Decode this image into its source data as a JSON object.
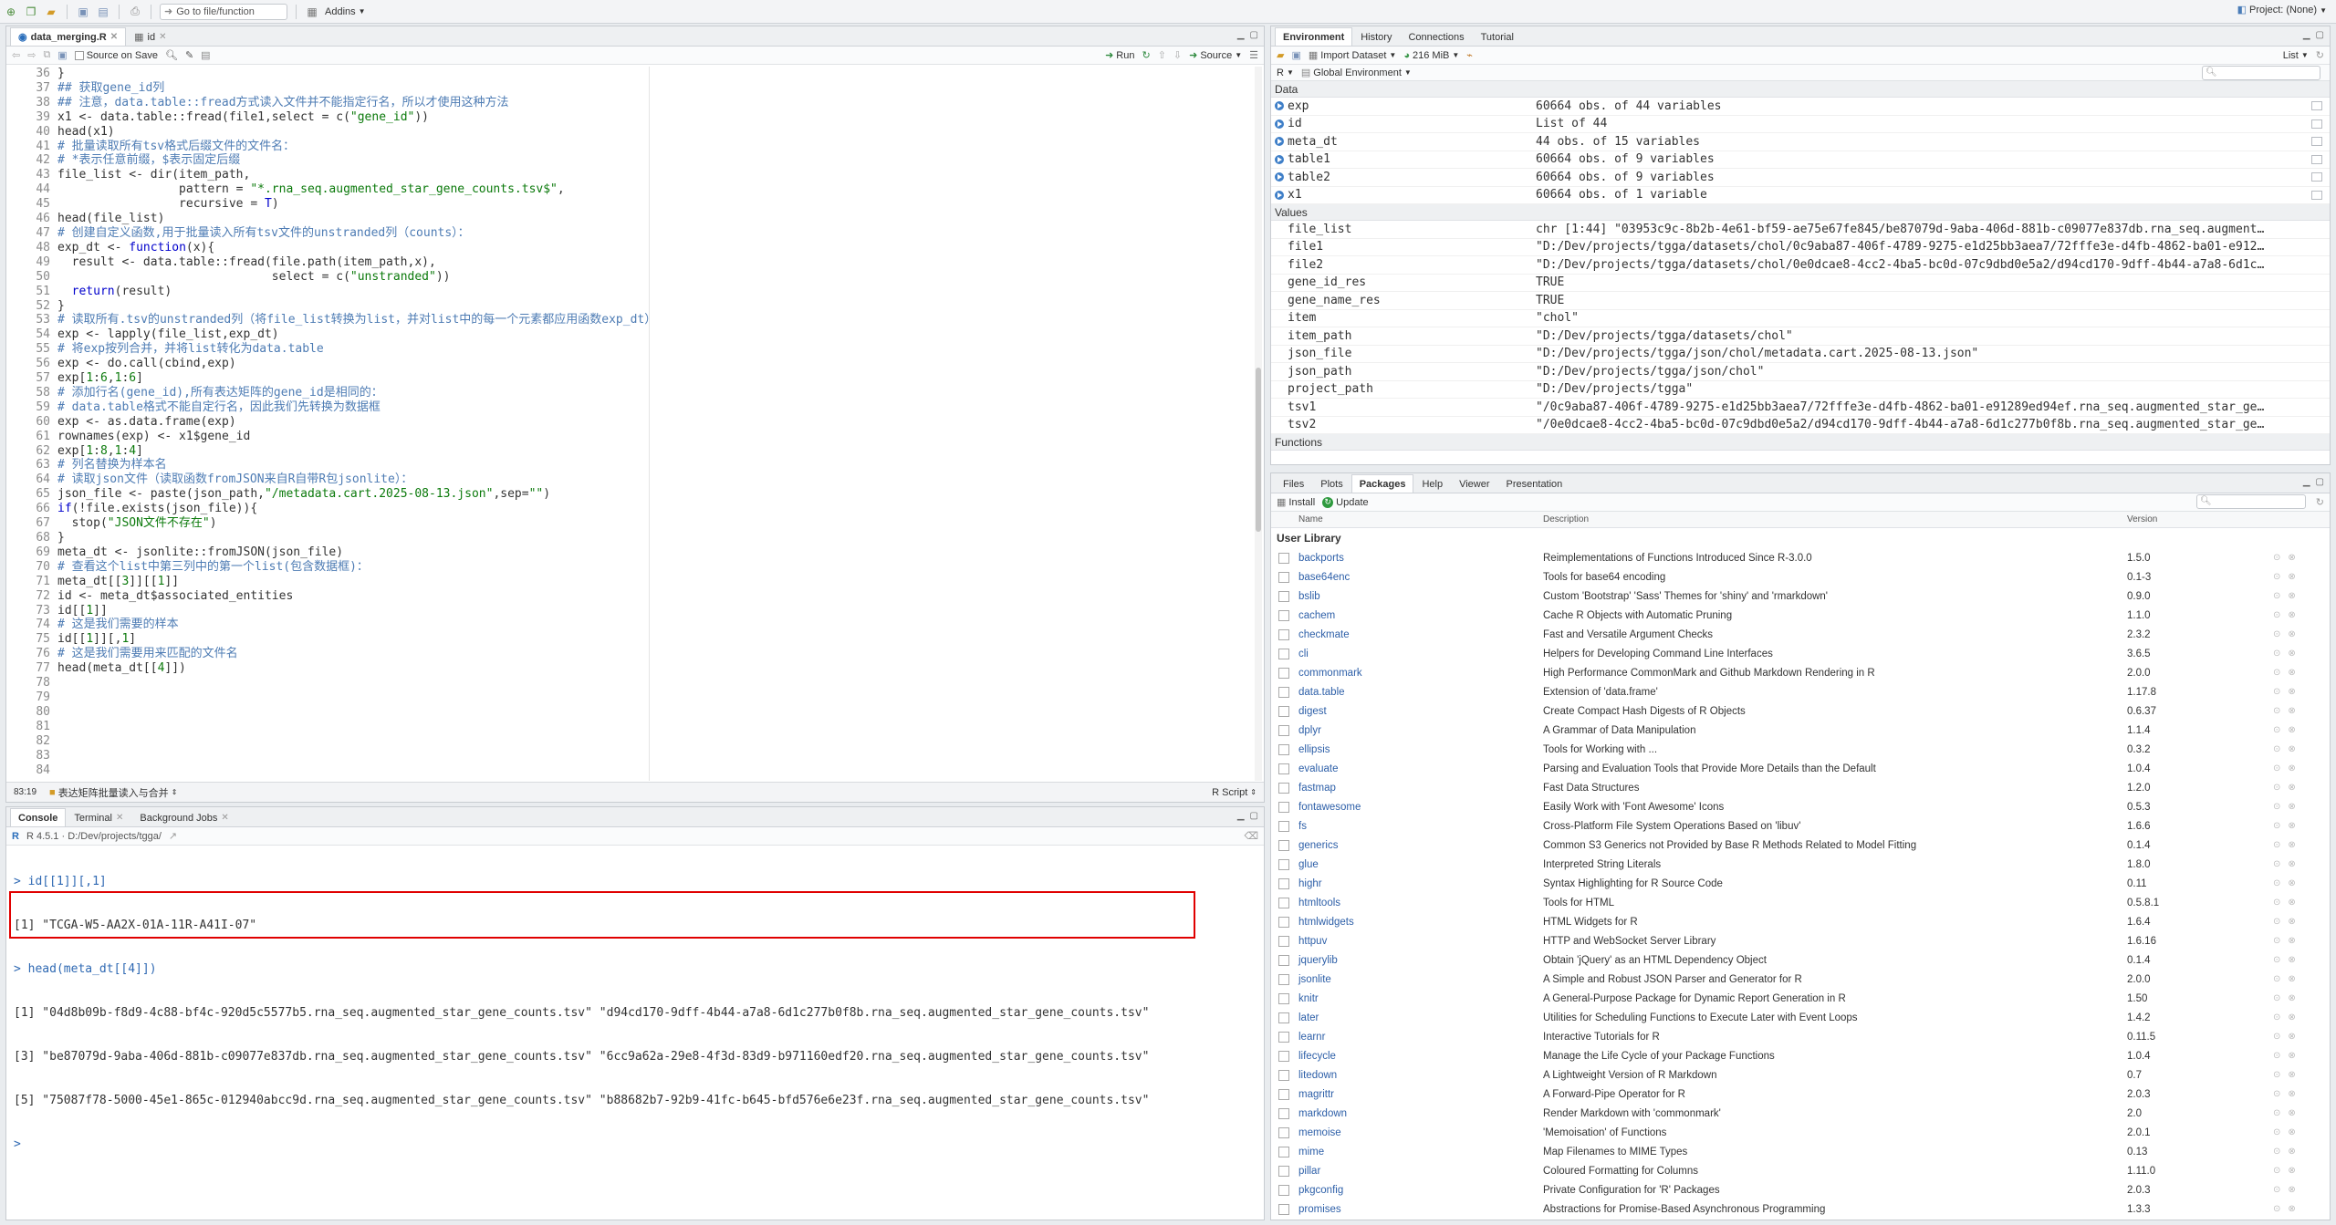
{
  "toolbar": {
    "goto_placeholder": "Go to file/function",
    "addins": "Addins",
    "project": "Project: (None)"
  },
  "editor": {
    "tabs": [
      {
        "label": "data_merging.R"
      },
      {
        "label": "id"
      }
    ],
    "source_on_save": "Source on Save",
    "run": "Run",
    "source": "Source",
    "status_pos": "83:19",
    "status_chunk": "表达矩阵批量读入与合并",
    "status_type": "R Script",
    "line_numbers": [
      "36",
      "37",
      "38",
      "39",
      "40",
      "41",
      "42",
      "43",
      "44",
      "45",
      "46",
      "47",
      "48",
      "49",
      "50",
      "51",
      "52",
      "53",
      "54",
      "55",
      "56",
      "57",
      "58",
      "59",
      "60",
      "61",
      "62",
      "63",
      "64",
      "65",
      "66",
      "67",
      "68",
      "69",
      "70",
      "71",
      "72",
      "73",
      "74",
      "75",
      "76",
      "77",
      "78",
      "79",
      "80",
      "81",
      "82",
      "83",
      "84"
    ]
  },
  "console": {
    "tabs": [
      {
        "label": "Console"
      },
      {
        "label": "Terminal"
      },
      {
        "label": "Background Jobs"
      }
    ],
    "path": "R 4.5.1 · D:/Dev/projects/tgga/",
    "lines": [
      "> id[[1]][,1]",
      "[1] \"TCGA-W5-AA2X-01A-11R-A41I-07\"",
      "> head(meta_dt[[4]])",
      "[1] \"04d8b09b-f8d9-4c88-bf4c-920d5c5577b5.rna_seq.augmented_star_gene_counts.tsv\" \"d94cd170-9dff-4b44-a7a8-6d1c277b0f8b.rna_seq.augmented_star_gene_counts.tsv\"",
      "[3] \"be87079d-9aba-406d-881b-c09077e837db.rna_seq.augmented_star_gene_counts.tsv\" \"6cc9a62a-29e8-4f3d-83d9-b971160edf20.rna_seq.augmented_star_gene_counts.tsv\"",
      "[5] \"75087f78-5000-45e1-865c-012940abcc9d.rna_seq.augmented_star_gene_counts.tsv\" \"b88682b7-92b9-41fc-b645-bfd576e6e23f.rna_seq.augmented_star_gene_counts.tsv\"",
      ">"
    ]
  },
  "environment": {
    "tabs": [
      {
        "label": "Environment"
      },
      {
        "label": "History"
      },
      {
        "label": "Connections"
      },
      {
        "label": "Tutorial"
      }
    ],
    "import_dataset": "Import Dataset",
    "memory": "216 MiB",
    "list_view": "List",
    "lang": "R",
    "scope": "Global Environment",
    "data_header": "Data",
    "data": [
      {
        "name": "exp",
        "value": "60664 obs. of 44 variables"
      },
      {
        "name": "id",
        "value": "List of  44"
      },
      {
        "name": "meta_dt",
        "value": "44 obs. of 15 variables"
      },
      {
        "name": "table1",
        "value": "60664 obs. of 9 variables"
      },
      {
        "name": "table2",
        "value": "60664 obs. of 9 variables"
      },
      {
        "name": "x1",
        "value": "60664 obs. of 1 variable"
      }
    ],
    "values_header": "Values",
    "values": [
      {
        "name": "file_list",
        "value": "chr [1:44] \"03953c9c-8b2b-4e61-bf59-ae75e67fe845/be87079d-9aba-406d-881b-c09077e837db.rna_seq.augment…"
      },
      {
        "name": "file1",
        "value": "\"D:/Dev/projects/tgga/datasets/chol/0c9aba87-406f-4789-9275-e1d25bb3aea7/72fffe3e-d4fb-4862-ba01-e912…"
      },
      {
        "name": "file2",
        "value": "\"D:/Dev/projects/tgga/datasets/chol/0e0dcae8-4cc2-4ba5-bc0d-07c9dbd0e5a2/d94cd170-9dff-4b44-a7a8-6d1c…"
      },
      {
        "name": "gene_id_res",
        "value": "TRUE"
      },
      {
        "name": "gene_name_res",
        "value": "TRUE"
      },
      {
        "name": "item",
        "value": "\"chol\""
      },
      {
        "name": "item_path",
        "value": "\"D:/Dev/projects/tgga/datasets/chol\""
      },
      {
        "name": "json_file",
        "value": "\"D:/Dev/projects/tgga/json/chol/metadata.cart.2025-08-13.json\""
      },
      {
        "name": "json_path",
        "value": "\"D:/Dev/projects/tgga/json/chol\""
      },
      {
        "name": "project_path",
        "value": "\"D:/Dev/projects/tgga\""
      },
      {
        "name": "tsv1",
        "value": "\"/0c9aba87-406f-4789-9275-e1d25bb3aea7/72fffe3e-d4fb-4862-ba01-e91289ed94ef.rna_seq.augmented_star_ge…"
      },
      {
        "name": "tsv2",
        "value": "\"/0e0dcae8-4cc2-4ba5-bc0d-07c9dbd0e5a2/d94cd170-9dff-4b44-a7a8-6d1c277b0f8b.rna_seq.augmented_star_ge…"
      }
    ],
    "functions_header": "Functions"
  },
  "packages": {
    "tabs": [
      {
        "label": "Files"
      },
      {
        "label": "Plots"
      },
      {
        "label": "Packages"
      },
      {
        "label": "Help"
      },
      {
        "label": "Viewer"
      },
      {
        "label": "Presentation"
      }
    ],
    "install": "Install",
    "update": "Update",
    "col_name": "Name",
    "col_desc": "Description",
    "col_ver": "Version",
    "user_library": "User Library",
    "rows": [
      {
        "name": "backports",
        "desc": "Reimplementations of Functions Introduced Since R-3.0.0",
        "ver": "1.5.0"
      },
      {
        "name": "base64enc",
        "desc": "Tools for base64 encoding",
        "ver": "0.1-3"
      },
      {
        "name": "bslib",
        "desc": "Custom 'Bootstrap' 'Sass' Themes for 'shiny' and 'rmarkdown'",
        "ver": "0.9.0"
      },
      {
        "name": "cachem",
        "desc": "Cache R Objects with Automatic Pruning",
        "ver": "1.1.0"
      },
      {
        "name": "checkmate",
        "desc": "Fast and Versatile Argument Checks",
        "ver": "2.3.2"
      },
      {
        "name": "cli",
        "desc": "Helpers for Developing Command Line Interfaces",
        "ver": "3.6.5"
      },
      {
        "name": "commonmark",
        "desc": "High Performance CommonMark and Github Markdown Rendering in R",
        "ver": "2.0.0"
      },
      {
        "name": "data.table",
        "desc": "Extension of 'data.frame'",
        "ver": "1.17.8"
      },
      {
        "name": "digest",
        "desc": "Create Compact Hash Digests of R Objects",
        "ver": "0.6.37"
      },
      {
        "name": "dplyr",
        "desc": "A Grammar of Data Manipulation",
        "ver": "1.1.4"
      },
      {
        "name": "ellipsis",
        "desc": "Tools for Working with ...",
        "ver": "0.3.2"
      },
      {
        "name": "evaluate",
        "desc": "Parsing and Evaluation Tools that Provide More Details than the Default",
        "ver": "1.0.4"
      },
      {
        "name": "fastmap",
        "desc": "Fast Data Structures",
        "ver": "1.2.0"
      },
      {
        "name": "fontawesome",
        "desc": "Easily Work with 'Font Awesome' Icons",
        "ver": "0.5.3"
      },
      {
        "name": "fs",
        "desc": "Cross-Platform File System Operations Based on 'libuv'",
        "ver": "1.6.6"
      },
      {
        "name": "generics",
        "desc": "Common S3 Generics not Provided by Base R Methods Related to Model Fitting",
        "ver": "0.1.4"
      },
      {
        "name": "glue",
        "desc": "Interpreted String Literals",
        "ver": "1.8.0"
      },
      {
        "name": "highr",
        "desc": "Syntax Highlighting for R Source Code",
        "ver": "0.11"
      },
      {
        "name": "htmltools",
        "desc": "Tools for HTML",
        "ver": "0.5.8.1"
      },
      {
        "name": "htmlwidgets",
        "desc": "HTML Widgets for R",
        "ver": "1.6.4"
      },
      {
        "name": "httpuv",
        "desc": "HTTP and WebSocket Server Library",
        "ver": "1.6.16"
      },
      {
        "name": "jquerylib",
        "desc": "Obtain 'jQuery' as an HTML Dependency Object",
        "ver": "0.1.4"
      },
      {
        "name": "jsonlite",
        "desc": "A Simple and Robust JSON Parser and Generator for R",
        "ver": "2.0.0"
      },
      {
        "name": "knitr",
        "desc": "A General-Purpose Package for Dynamic Report Generation in R",
        "ver": "1.50"
      },
      {
        "name": "later",
        "desc": "Utilities for Scheduling Functions to Execute Later with Event Loops",
        "ver": "1.4.2"
      },
      {
        "name": "learnr",
        "desc": "Interactive Tutorials for R",
        "ver": "0.11.5"
      },
      {
        "name": "lifecycle",
        "desc": "Manage the Life Cycle of your Package Functions",
        "ver": "1.0.4"
      },
      {
        "name": "litedown",
        "desc": "A Lightweight Version of R Markdown",
        "ver": "0.7"
      },
      {
        "name": "magrittr",
        "desc": "A Forward-Pipe Operator for R",
        "ver": "2.0.3"
      },
      {
        "name": "markdown",
        "desc": "Render Markdown with 'commonmark'",
        "ver": "2.0"
      },
      {
        "name": "memoise",
        "desc": "'Memoisation' of Functions",
        "ver": "2.0.1"
      },
      {
        "name": "mime",
        "desc": "Map Filenames to MIME Types",
        "ver": "0.13"
      },
      {
        "name": "pillar",
        "desc": "Coloured Formatting for Columns",
        "ver": "1.11.0"
      },
      {
        "name": "pkgconfig",
        "desc": "Private Configuration for 'R' Packages",
        "ver": "2.0.3"
      },
      {
        "name": "promises",
        "desc": "Abstractions for Promise-Based Asynchronous Programming",
        "ver": "1.3.3"
      }
    ]
  }
}
